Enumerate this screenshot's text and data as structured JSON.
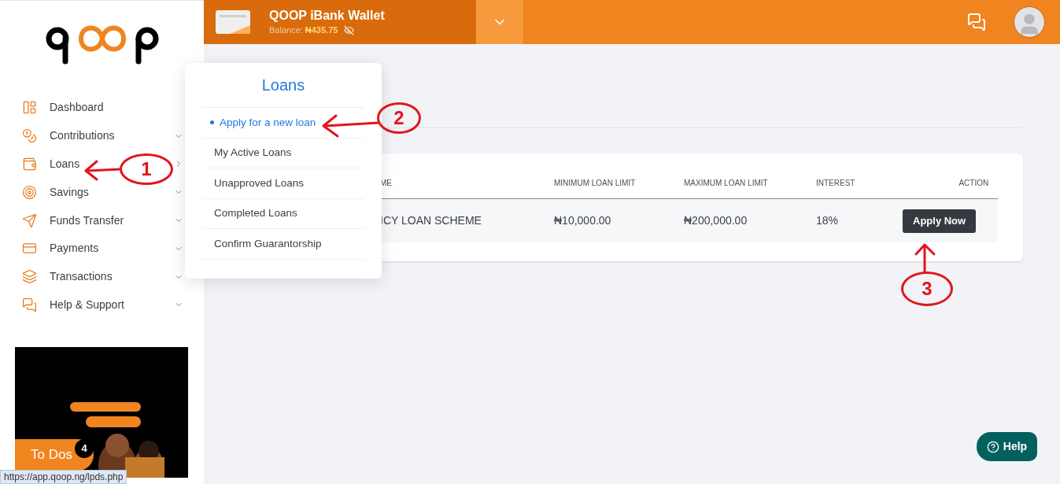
{
  "sidebar": {
    "items": [
      {
        "label": "Dashboard"
      },
      {
        "label": "Contributions",
        "expanded": false
      },
      {
        "label": "Loans",
        "expanded": true
      },
      {
        "label": "Savings",
        "expanded": false
      },
      {
        "label": "Funds Transfer",
        "expanded": false
      },
      {
        "label": "Payments",
        "expanded": false
      },
      {
        "label": "Transactions",
        "expanded": false
      },
      {
        "label": "Help & Support",
        "expanded": false
      }
    ]
  },
  "wallet": {
    "title": "QOOP iBank Wallet",
    "balance_label": "Balance:",
    "balance": "₦435.75"
  },
  "loans_menu": {
    "title": "Loans",
    "items": [
      {
        "label": "Apply for a new loan",
        "selected": true
      },
      {
        "label": "My Active Loans",
        "selected": false
      },
      {
        "label": "Unapproved Loans",
        "selected": false
      },
      {
        "label": "Completed Loans",
        "selected": false
      },
      {
        "label": "Confirm Guarantorship",
        "selected": false
      }
    ]
  },
  "table": {
    "columns": [
      "ME",
      "MINIMUM LOAN LIMIT",
      "MAXIMUM LOAN LIMIT",
      "INTEREST",
      "ACTION"
    ],
    "rows": [
      {
        "cells": [
          "ICY LOAN SCHEME",
          "₦10,000.00",
          "₦200,000.00",
          "18%"
        ],
        "action": "Apply Now"
      }
    ]
  },
  "todos": {
    "label": "To Dos",
    "count": "4"
  },
  "help": {
    "label": "Help"
  },
  "status_bar": {
    "url": "https://app.qoop.ng/lpds.php"
  },
  "annotations": [
    {
      "label": "1"
    },
    {
      "label": "2"
    },
    {
      "label": "3"
    }
  ]
}
